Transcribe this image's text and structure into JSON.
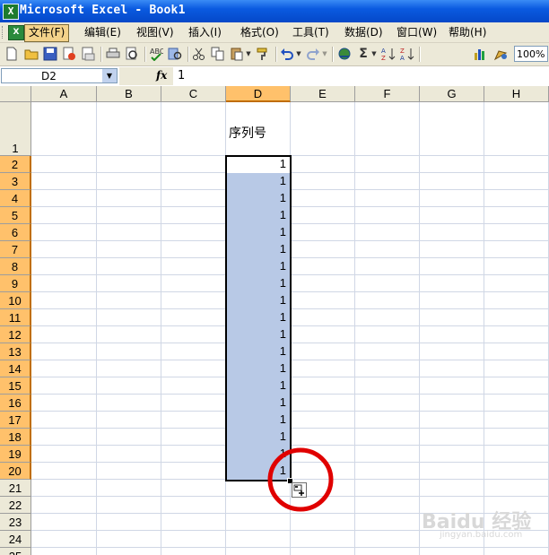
{
  "window": {
    "title": "Microsoft Excel - Book1",
    "app_icon_label": "X"
  },
  "menu": {
    "items": [
      {
        "label": "文件(F)"
      },
      {
        "label": "编辑(E)"
      },
      {
        "label": "视图(V)"
      },
      {
        "label": "插入(I)"
      },
      {
        "label": "格式(O)"
      },
      {
        "label": "工具(T)"
      },
      {
        "label": "数据(D)"
      },
      {
        "label": "窗口(W)"
      },
      {
        "label": "帮助(H)"
      }
    ]
  },
  "toolbar": {
    "icons": [
      "new-icon",
      "open-icon",
      "save-icon",
      "permission-icon",
      "email-icon",
      "print-icon",
      "print-preview-icon",
      "spelling-icon",
      "research-icon",
      "cut-icon",
      "copy-icon",
      "paste-icon",
      "format-painter-icon",
      "undo-icon",
      "redo-icon",
      "hyperlink-icon",
      "autosum-icon",
      "sort-ascending-icon",
      "sort-descending-icon",
      "chart-wizard-icon",
      "drawing-icon"
    ],
    "autosum_symbol": "Σ",
    "zoom": "100%"
  },
  "formula_bar": {
    "name_box": "D2",
    "fx_label": "fx",
    "formula": "1"
  },
  "sheet": {
    "columns": [
      "A",
      "B",
      "C",
      "D",
      "E",
      "F",
      "G",
      "H"
    ],
    "selected_column": "D",
    "rows": [
      "1",
      "2",
      "3",
      "4",
      "5",
      "6",
      "7",
      "8",
      "9",
      "10",
      "11",
      "12",
      "13",
      "14",
      "15",
      "16",
      "17",
      "18",
      "19",
      "20",
      "21",
      "22",
      "23",
      "24",
      "25"
    ],
    "selected_rows": [
      "2",
      "3",
      "4",
      "5",
      "6",
      "7",
      "8",
      "9",
      "10",
      "11",
      "12",
      "13",
      "14",
      "15",
      "16",
      "17",
      "18",
      "19",
      "20"
    ],
    "d1_text": "序列号",
    "d_values": [
      "1",
      "1",
      "1",
      "1",
      "1",
      "1",
      "1",
      "1",
      "1",
      "1",
      "1",
      "1",
      "1",
      "1",
      "1",
      "1",
      "1",
      "1",
      "1"
    ],
    "selection_color": "#b8c9e6",
    "header_highlight": "#ffc16b"
  },
  "overlay": {
    "annotation_color": "#e00000",
    "watermark": "Baidu 经验",
    "watermark_sub": "jingyan.baidu.com"
  }
}
